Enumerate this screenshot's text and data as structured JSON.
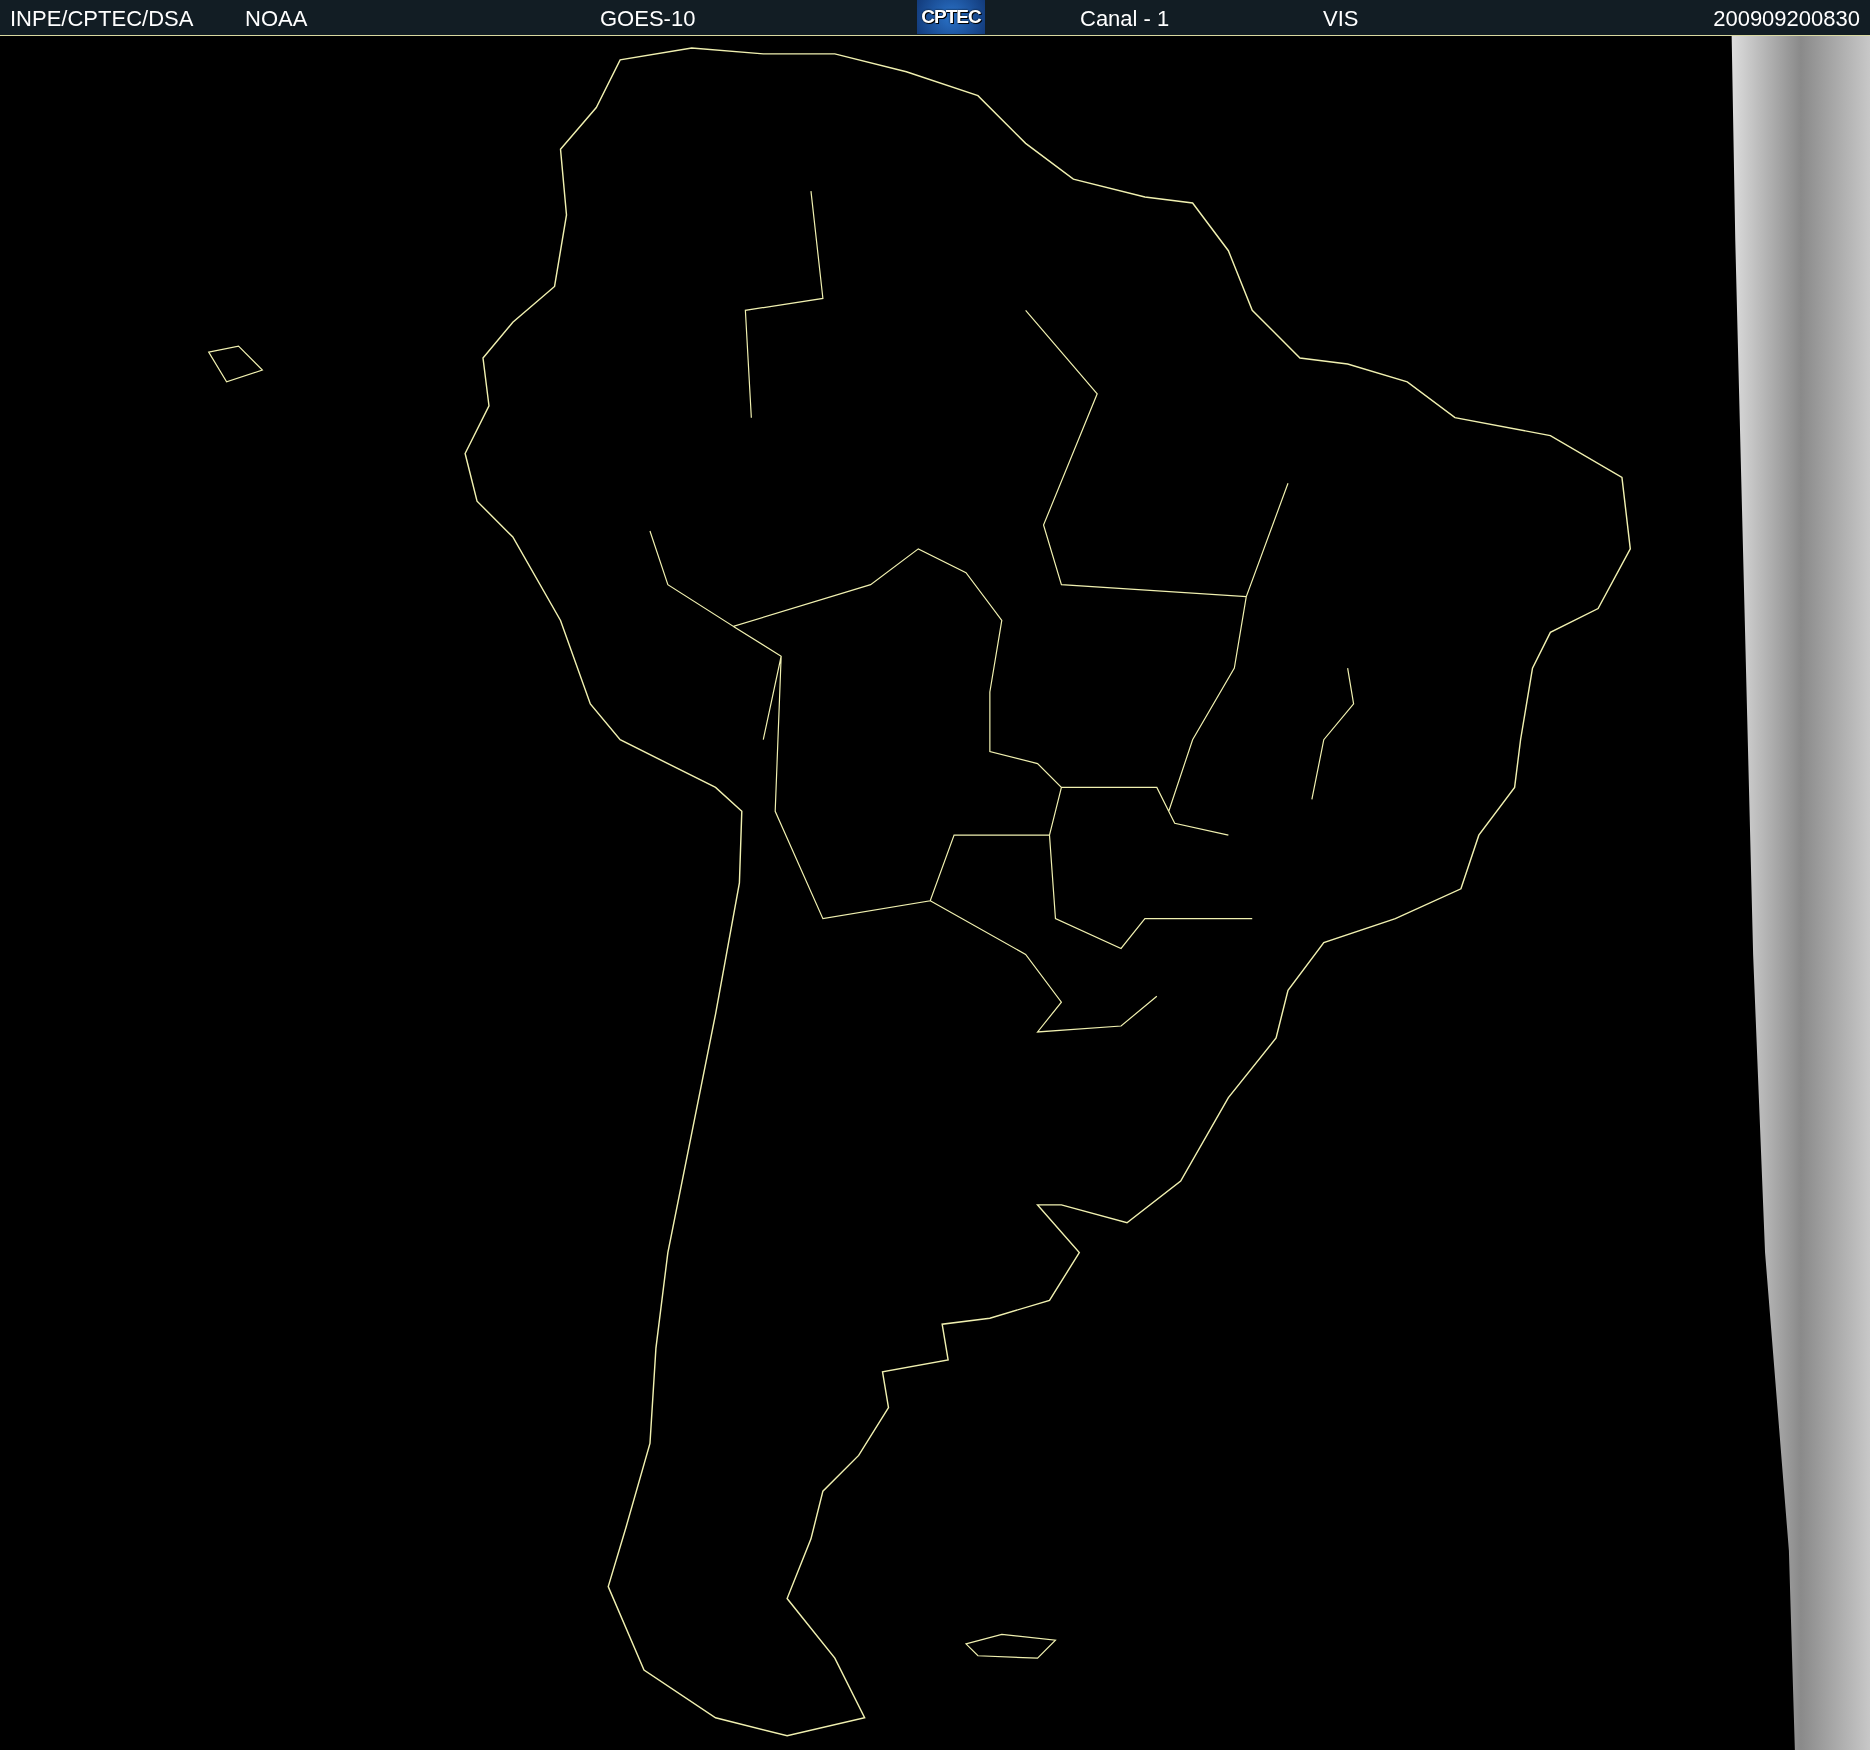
{
  "header": {
    "source": "INPE/CPTEC/DSA",
    "agency": "NOAA",
    "satellite": "GOES-10",
    "logo": "CPTEC",
    "channel": "Canal - 1",
    "band": "VIS",
    "timestamp": "200909200830"
  }
}
